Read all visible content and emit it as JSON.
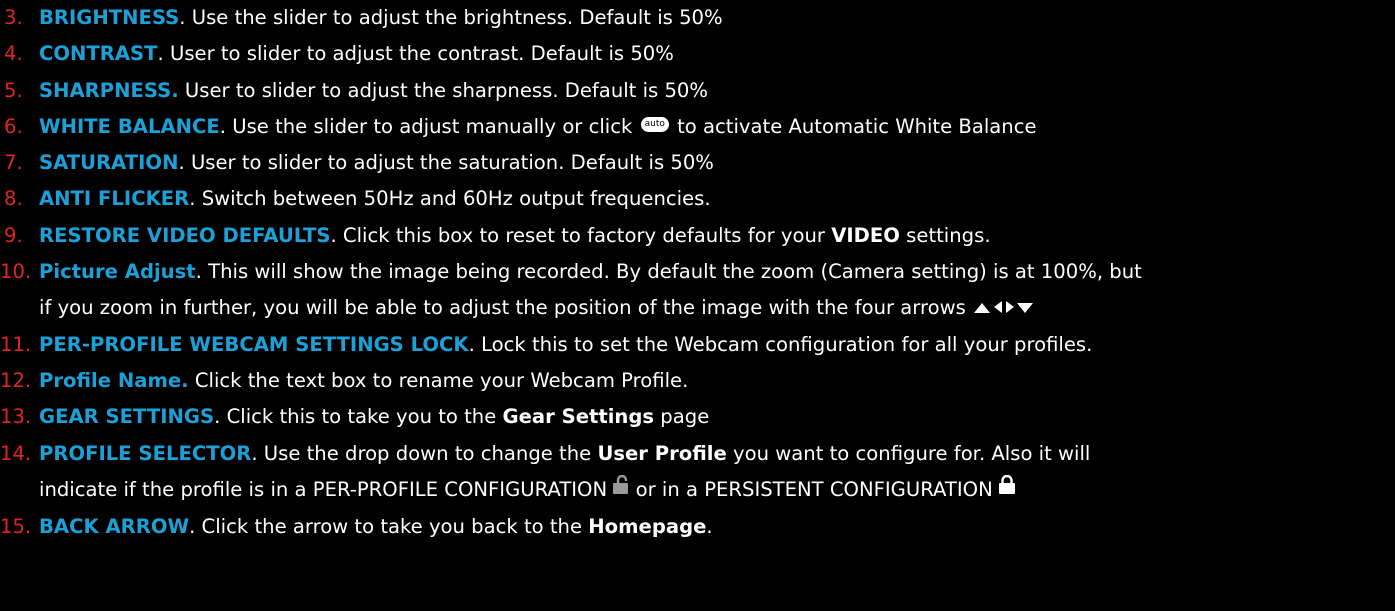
{
  "colors": {
    "background": "#000000",
    "number": "#e02424",
    "term": "#1ba0d8",
    "text": "#ffffff"
  },
  "items": [
    {
      "number": "3.",
      "term": "BRIGHTNESS",
      "text": ".  Use the slider to adjust the brightness.  Default is 50%"
    },
    {
      "number": "4.",
      "term": "CONTRAST",
      "text": ".  User to slider to adjust the contrast.  Default is 50%"
    },
    {
      "number": "5.",
      "term": "SHARPNESS.",
      "text": "  User to slider to adjust the sharpness.  Default is 50%"
    },
    {
      "number": "6.",
      "term": "WHITE BALANCE",
      "text_before": ".  Use the slider to adjust manually or click ",
      "button_label": "auto",
      "text_after": " to activate Automatic White Balance"
    },
    {
      "number": "7.",
      "term": "SATURATION",
      "text": ".  User to slider to adjust the saturation.  Default is 50%"
    },
    {
      "number": "8.",
      "term": "ANTI FLICKER",
      "text": ".  Switch between 50Hz and 60Hz output frequencies."
    },
    {
      "number": "9.",
      "term": "RESTORE VIDEO DEFAULTS",
      "text_before": ".  Click this box to reset to factory defaults for your ",
      "bold": "VIDEO",
      "text_after": " settings."
    },
    {
      "number": "10.",
      "term": "Picture Adjust",
      "line1": ".  This will show the image being recorded.  By default the zoom (Camera setting) is at 100%, but",
      "line2": "if you zoom in further, you will be able to adjust the position of the image with the four arrows ",
      "arrows_icon": "four-direction-arrows-icon"
    },
    {
      "number": "11.",
      "term": "PER-PROFILE WEBCAM SETTINGS LOCK",
      "text": ".  Lock this to set the Webcam configuration for all your profiles."
    },
    {
      "number": "12.",
      "term": "Profile Name.",
      "text": " Click the text box to rename your Webcam Profile."
    },
    {
      "number": "13.",
      "term": "GEAR SETTINGS",
      "text_before": ".  Click this to take you to the ",
      "bold": "Gear Settings",
      "text_after": " page"
    },
    {
      "number": "14.",
      "term": "PROFILE SELECTOR",
      "line1_before": ".  Use the drop down to change the ",
      "line1_bold": "User Profile",
      "line1_after": " you want to configure for. Also it will",
      "line2_before": "indicate if the profile is in a PER-PROFILE CONFIGURATION ",
      "line2_middle": " or in a PERSISTENT CONFIGURATION ",
      "unlocked_icon": "unlocked-padlock-icon",
      "locked_icon": "locked-padlock-icon"
    },
    {
      "number": "15.",
      "term": "BACK ARROW",
      "text_before": ".  Click the arrow to take you back to the ",
      "bold": "Homepage",
      "text_after": "."
    }
  ]
}
